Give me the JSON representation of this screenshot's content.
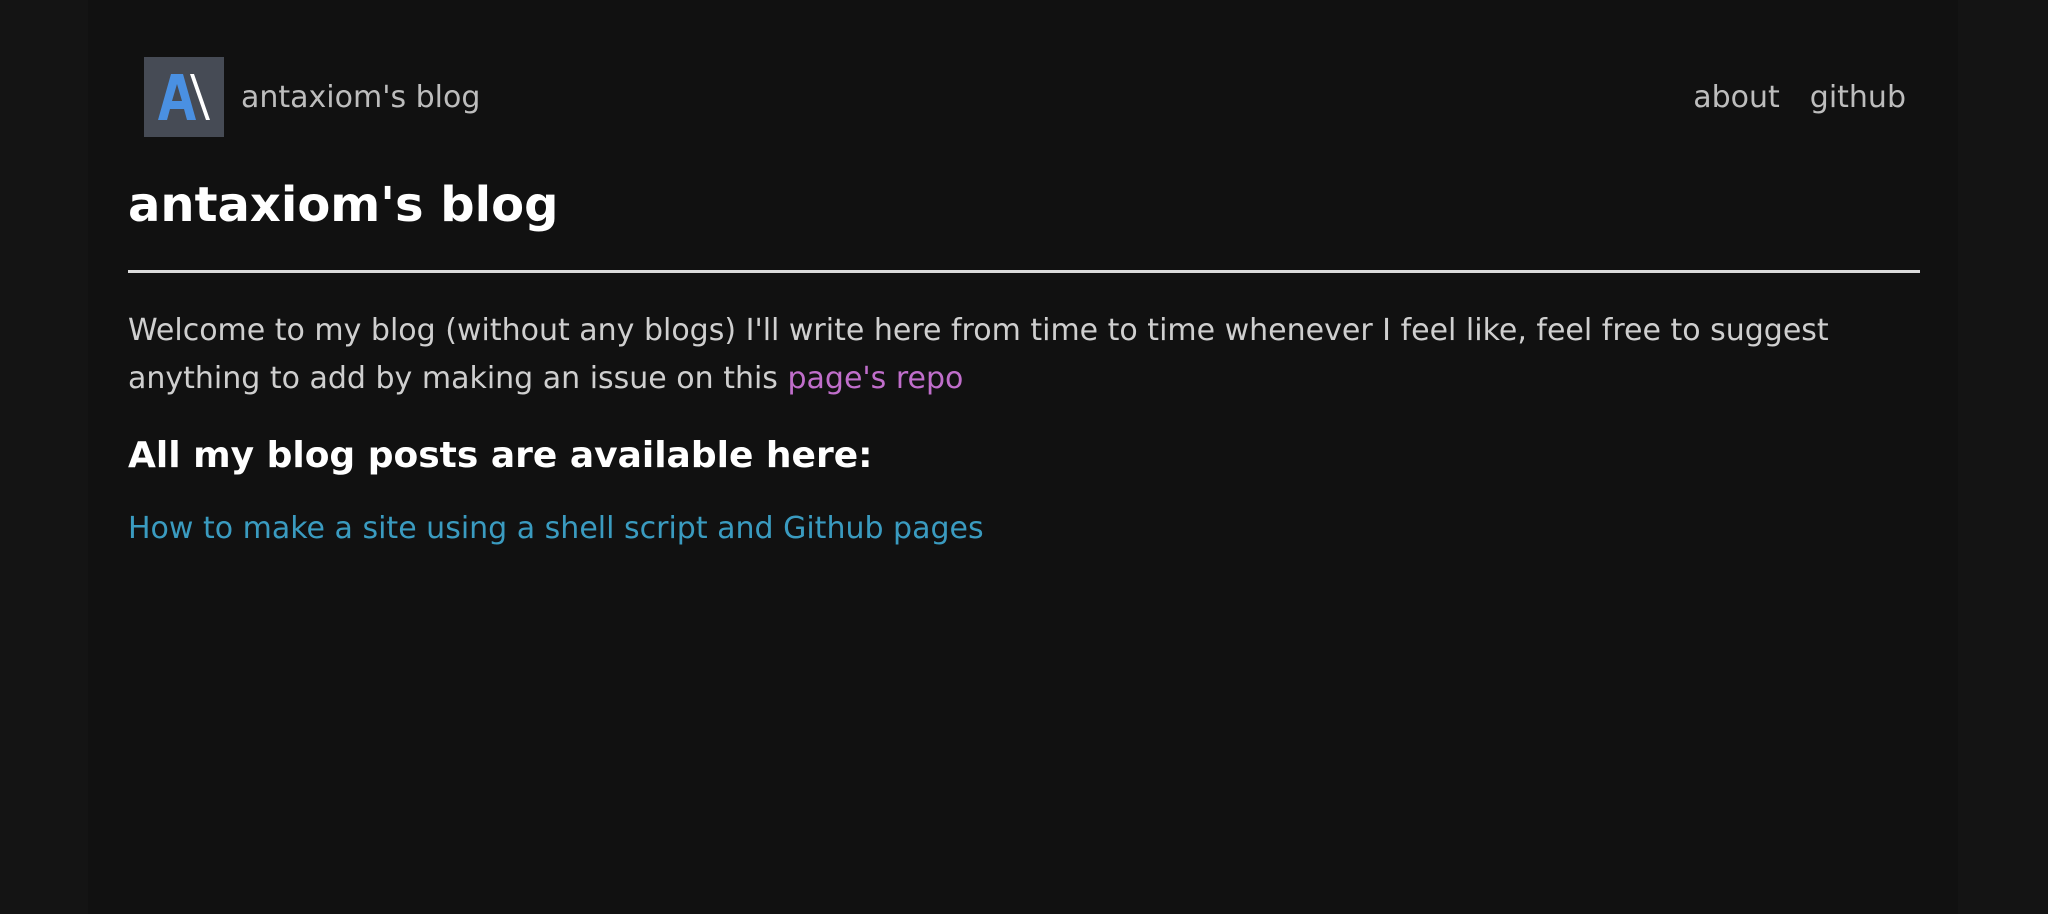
{
  "nav": {
    "brand_text": "antaxiom's blog",
    "links": [
      "about",
      "github"
    ]
  },
  "main": {
    "title": "antaxiom's blog",
    "intro_text": "Welcome to my blog (without any blogs) I'll write here from time to time whenever I feel like, feel free to suggest anything to add by making an issue on this ",
    "repo_link": "page's repo",
    "posts_heading": "All my blog posts are available here:",
    "posts": [
      "How to make a site using a shell script and Github pages"
    ]
  },
  "colors": {
    "background": "#111111",
    "link_purple": "#c06ecb",
    "link_blue": "#3a9bc0",
    "logo_blue": "#4a90e2"
  }
}
